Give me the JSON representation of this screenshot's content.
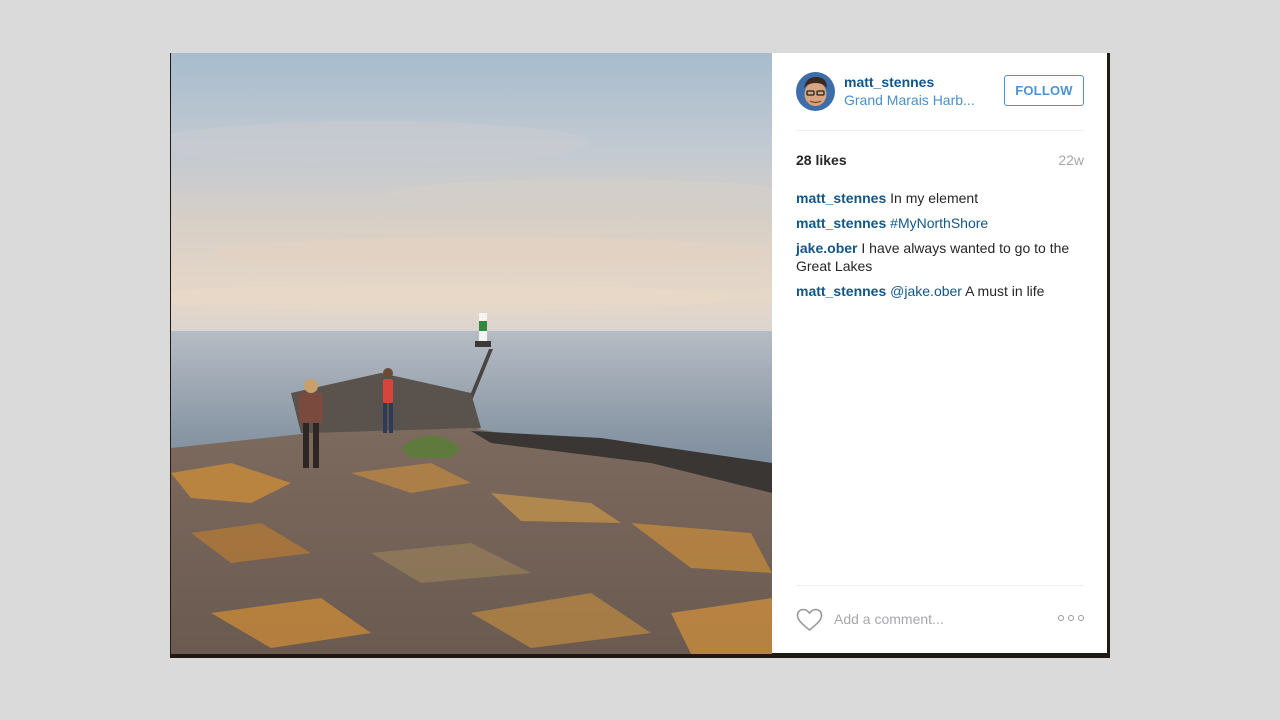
{
  "post": {
    "username": "matt_stennes",
    "location": "Grand Marais Harb...",
    "follow_label": "FOLLOW",
    "likes": "28 likes",
    "time": "22w",
    "comments": [
      {
        "user": "matt_stennes",
        "text": "In my element"
      },
      {
        "user": "matt_stennes",
        "tag": "#MyNorthShore"
      },
      {
        "user": "jake.ober",
        "text": "I have always wanted to go to the Great Lakes"
      },
      {
        "user": "matt_stennes",
        "mention": "@jake.ober",
        "text": "A must in life"
      }
    ],
    "comment_placeholder": "Add a comment...",
    "icons": {
      "like": "heart-outline-icon",
      "more": "more-options-icon"
    }
  },
  "colors": {
    "username": "#125688",
    "location": "#4a90c8",
    "follow_border": "#4d92d6",
    "muted": "#a5a7aa",
    "backdrop": "#dadada"
  }
}
